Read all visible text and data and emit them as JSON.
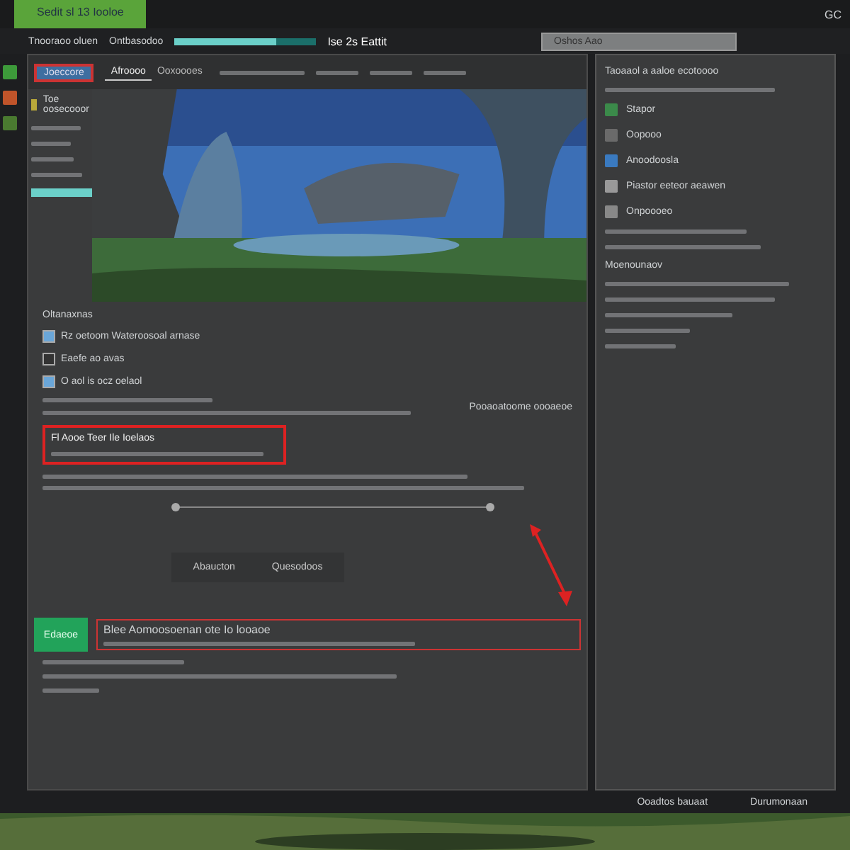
{
  "top_bar": {
    "app_label": "Sedit sl 13 Iooloe",
    "tray_label": "GC"
  },
  "title_bar": {
    "path": "Tnooraoo oluen",
    "filter": "Ontbasodoo",
    "progress": {
      "level": 0.72
    },
    "site": "Ise 2s Eattit",
    "dropdown": "Oshos Aao"
  },
  "toolbar": {
    "selected_button": "Joeccore",
    "tabs": [
      {
        "label": "Afroooo",
        "selected": true
      },
      {
        "label": "Ooxoooes",
        "selected": false
      }
    ]
  },
  "sidebar": {
    "heading": "Toe oosecooor",
    "progress": {
      "level": 0.6
    }
  },
  "settings": {
    "heading": "Oltanaxnas",
    "rows": [
      {
        "label": "Rz oetoom Wateroosoal arnase",
        "checked": true
      },
      {
        "label": "Eaefe ao avas",
        "checked": false
      },
      {
        "label": "O aol is ocz oelaol",
        "checked": true
      }
    ],
    "highlight": "Fl Aooe Teer Ile Ioelaos",
    "side_note": "Pooaoatoome oooaeoe"
  },
  "actions": [
    {
      "label": "Abaucton"
    },
    {
      "label": "Quesodoos"
    }
  ],
  "result": {
    "button": "Edaeoe",
    "line": "Blee Aomoosoenan ote Io looaoe"
  },
  "right_panel": {
    "heading": "Taoaaol a aaloe ecotoooo",
    "items": [
      {
        "title": "Stapor"
      },
      {
        "title": "Oopooo"
      },
      {
        "title": "Anoodoosla"
      },
      {
        "title": "Piastor eeteor aeawen"
      },
      {
        "title": "Onpoooeo"
      }
    ],
    "section": "Moenounaov"
  },
  "status": [
    {
      "label": "Ooadtos bauaat"
    },
    {
      "label": "Durumonaan"
    }
  ]
}
